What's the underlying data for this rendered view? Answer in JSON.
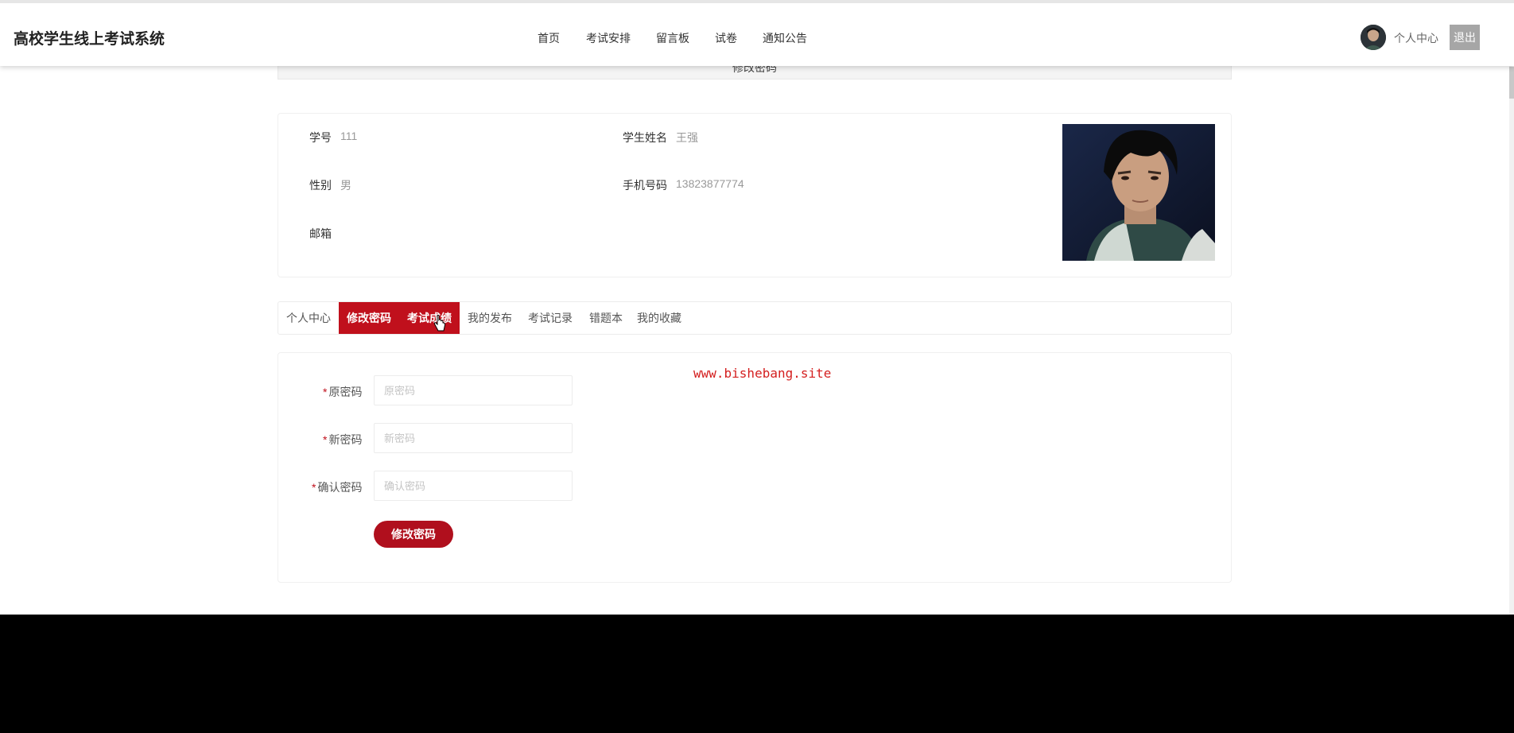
{
  "header": {
    "site_title": "高校学生线上考试系统",
    "nav": [
      "首页",
      "考试安排",
      "留言板",
      "试卷",
      "通知公告"
    ],
    "user_center": "个人中心",
    "logout": "退出"
  },
  "page_title": "修改密码",
  "profile": {
    "student_id_label": "学号",
    "student_id": "111",
    "name_label": "学生姓名",
    "name": "王强",
    "gender_label": "性别",
    "gender": "男",
    "phone_label": "手机号码",
    "phone": "13823877774",
    "email_label": "邮箱",
    "email": ""
  },
  "tabs": [
    "个人中心",
    "修改密码",
    "考试成绩",
    "我的发布",
    "考试记录",
    "错题本",
    "我的收藏"
  ],
  "active_tab": "修改密码",
  "form": {
    "old_password": {
      "label": "原密码",
      "placeholder": "原密码"
    },
    "new_password": {
      "label": "新密码",
      "placeholder": "新密码"
    },
    "confirm_password": {
      "label": "确认密码",
      "placeholder": "确认密码"
    },
    "submit": "修改密码"
  },
  "watermark": "www.bishebang.site",
  "colors": {
    "accent": "#c0101c",
    "button": "#b00f1d",
    "logout_bg": "#a6a6a6"
  }
}
